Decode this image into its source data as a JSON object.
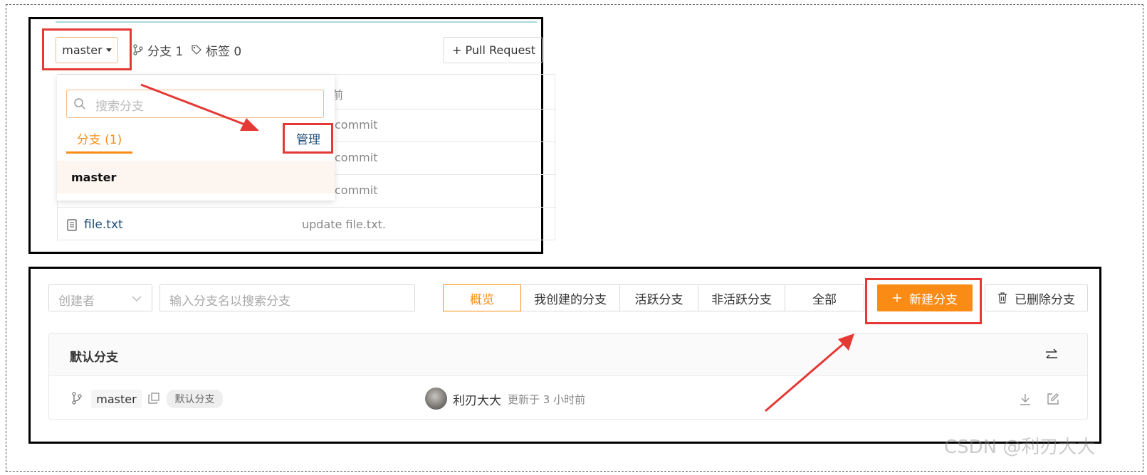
{
  "top": {
    "branch_select": "master",
    "branch_count_label": "分支 1",
    "tag_count_label": "标签 0",
    "pull_request_label": "+ Pull Request",
    "table_header_partial": "前",
    "commit_texts": [
      "commit",
      "commit",
      "commit"
    ],
    "file": {
      "name": "file.txt",
      "message": "update file.txt."
    },
    "dropdown": {
      "search_placeholder": "搜索分支",
      "tab_label": "分支 (1)",
      "manage_label": "管理",
      "branches": [
        "master"
      ]
    }
  },
  "bottom": {
    "creator_placeholder": "创建者",
    "search_placeholder": "输入分支名以搜索分支",
    "filters": [
      "概览",
      "我创建的分支",
      "活跃分支",
      "非活跃分支",
      "全部"
    ],
    "new_branch_label": "新建分支",
    "deleted_label": "已删除分支",
    "section_title": "默认分支",
    "branch_row": {
      "name": "master",
      "badge": "默认分支",
      "author": "利刃大大",
      "updated": "更新于 3 小时前"
    }
  },
  "watermark": "CSDN @利刃大大",
  "colors": {
    "accent": "#fa8c16",
    "annotation": "#e53935",
    "link": "#1f4e79"
  }
}
